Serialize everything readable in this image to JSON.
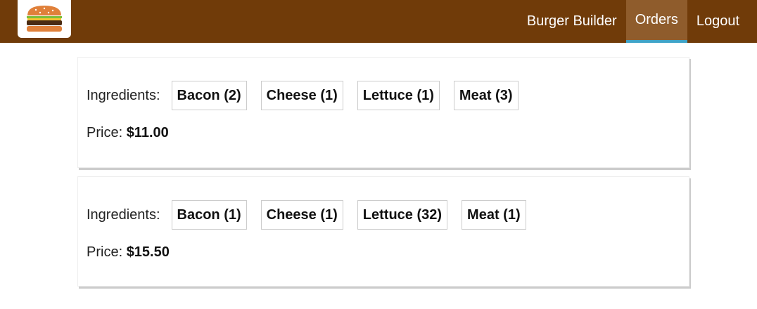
{
  "nav": {
    "logo": "burger-logo",
    "items": [
      {
        "label": "Burger Builder",
        "active": false
      },
      {
        "label": "Orders",
        "active": true
      },
      {
        "label": "Logout",
        "active": false
      }
    ]
  },
  "colors": {
    "toolbar_bg": "#703b09",
    "active_bg": "#8f5c2c",
    "active_underline": "#40a4c8"
  },
  "orders": [
    {
      "ingredients_label": "Ingredients:",
      "ingredients": [
        "Bacon (2)",
        "Cheese (1)",
        "Lettuce (1)",
        "Meat (3)"
      ],
      "price_label": "Price:",
      "price": "$11.00"
    },
    {
      "ingredients_label": "Ingredients:",
      "ingredients": [
        "Bacon (1)",
        "Cheese (1)",
        "Lettuce (32)",
        "Meat (1)"
      ],
      "price_label": "Price:",
      "price": "$15.50"
    }
  ]
}
